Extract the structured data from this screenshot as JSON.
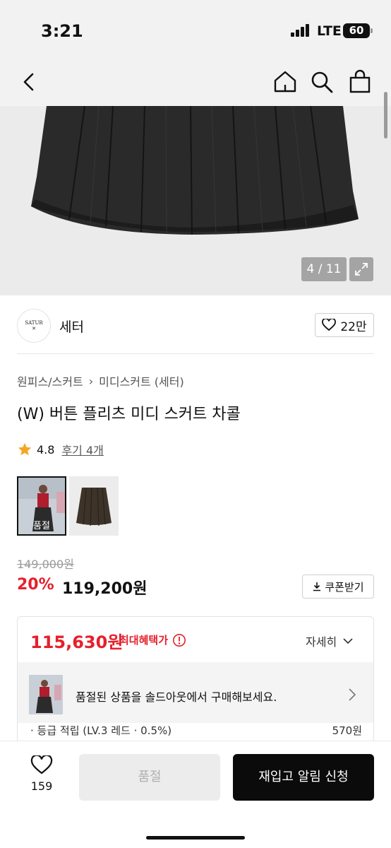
{
  "status_bar": {
    "time": "3:21",
    "network": "LTE",
    "battery": "60"
  },
  "nav": {
    "back": "back-icon",
    "home": "home-icon",
    "search": "search-icon",
    "cart": "shopping-bag-icon"
  },
  "gallery": {
    "counter": "4 / 11",
    "expand": "expand-icon"
  },
  "brand": {
    "logo_text_top": "SATUR",
    "logo_text_bottom": "✕",
    "name": "세터",
    "likes": "22만"
  },
  "product": {
    "breadcrumb": [
      "원피스/스커트",
      "미디스커트 (세터)"
    ],
    "title": "(W) 버튼 플리츠 미디 스커트 차콜",
    "rating": "4.8",
    "reviews": "후기 4개",
    "thumb_label": "품절"
  },
  "price": {
    "original": "149,000원",
    "discount": "20%",
    "sale": "119,200원",
    "coupon_label": "쿠폰받기"
  },
  "benefit": {
    "max_price": "115,630원",
    "max_label": "최대혜택가",
    "detail_label": "자세히",
    "banner_text": "품절된 상품을 솔드아웃에서 구매해보세요.",
    "cut_row_left": "· 등급 적립 (LV.3 레드 · 0.5%)",
    "cut_row_right": "570원"
  },
  "bottom": {
    "wish_count": "159",
    "soldout_label": "품절",
    "restock_label": "재입고 알림 신청"
  },
  "colors": {
    "accent_red": "#e5202c",
    "dark": "#0b0b0b"
  }
}
